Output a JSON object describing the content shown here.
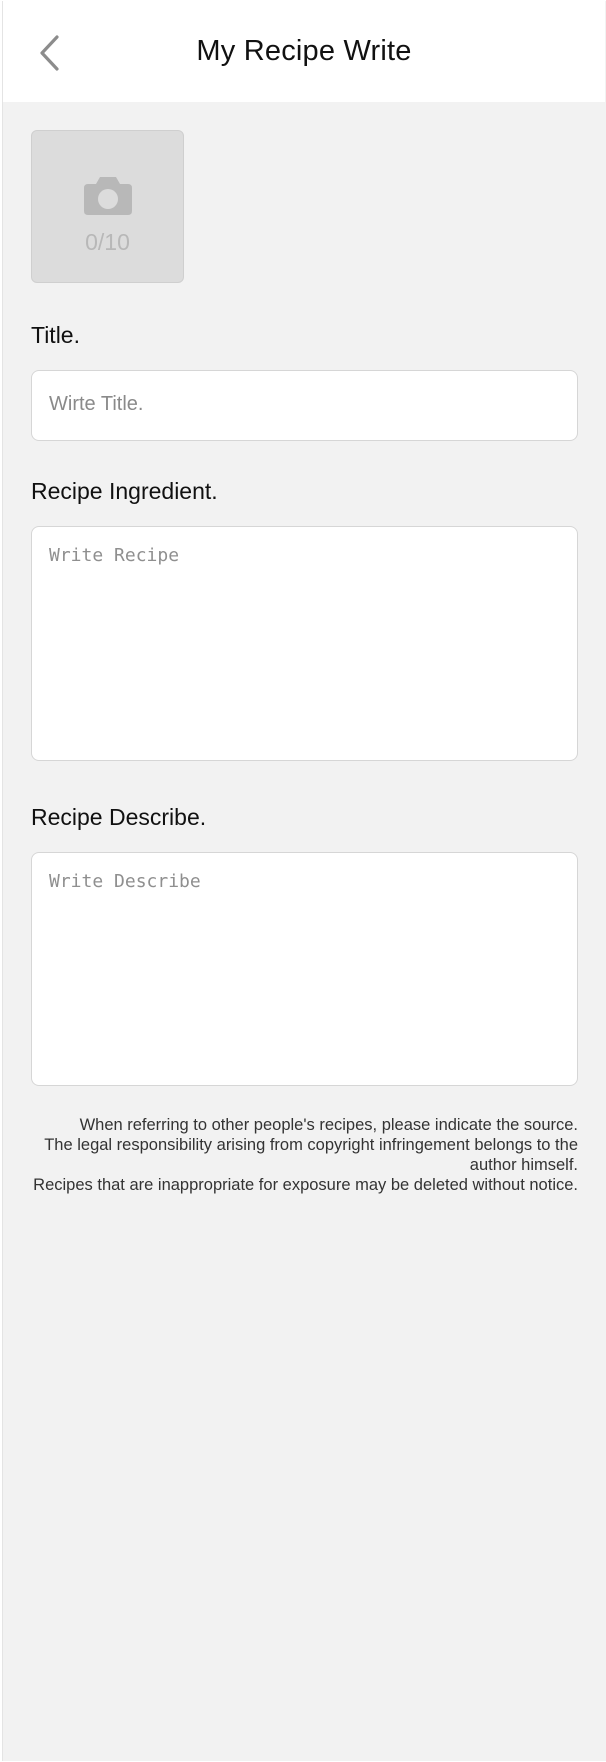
{
  "header": {
    "title": "My Recipe Write",
    "back_icon": "chevron-left-icon"
  },
  "photo": {
    "icon": "camera-icon",
    "count": "0/10"
  },
  "title_field": {
    "label": "Title.",
    "placeholder": "Wirte Title."
  },
  "ingredient_field": {
    "label": "Recipe Ingredient.",
    "placeholder": "Write Recipe"
  },
  "describe_field": {
    "label": "Recipe Describe.",
    "placeholder": "Write Describe"
  },
  "notice": {
    "lines": [
      "When referring to other people's recipes, please indicate the source.",
      "The legal responsibility arising from copyright infringement belongs to the author himself.",
      "Recipes that are inappropriate for exposure may be deleted without notice."
    ]
  },
  "colors": {
    "background": "#f2f2f2",
    "header_bg": "#ffffff",
    "photo_box_bg": "#dcdcdc",
    "icon_gray": "#b8b8b8",
    "placeholder_gray": "#8a8a8a"
  }
}
